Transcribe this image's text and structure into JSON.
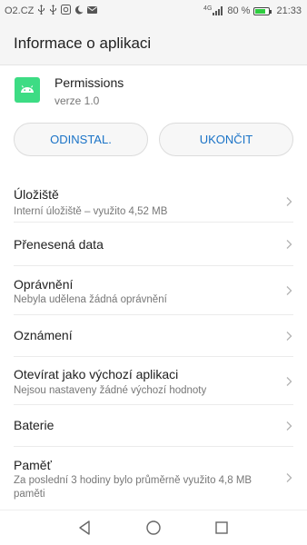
{
  "status_bar": {
    "carrier": "O2.CZ",
    "network": "4G",
    "battery": "80 %",
    "battery_level": 0.8,
    "time": "21:33",
    "icons": [
      "usb-icon",
      "usb-icon",
      "shield-icon",
      "moon-icon",
      "mail-icon"
    ]
  },
  "header": {
    "title": "Informace o aplikaci"
  },
  "app": {
    "name": "Permissions",
    "version": "verze 1.0",
    "icon": "android-icon",
    "icon_color": "#3ddc84"
  },
  "buttons": {
    "uninstall": "ODINSTAL.",
    "force_stop": "UKONČIT",
    "accent_color": "#1a73c7"
  },
  "list": [
    {
      "title": "Úložiště",
      "subtitle": "Interní úložiště – využito 4,52 MB"
    },
    {
      "title": "Přenesená data",
      "subtitle": ""
    },
    {
      "title": "Oprávnění",
      "subtitle": "Nebyla udělena žádná oprávnění"
    },
    {
      "title": "Oznámení",
      "subtitle": ""
    },
    {
      "title": "Otevírat jako výchozí aplikaci",
      "subtitle": "Nejsou nastaveny žádné výchozí hodnoty"
    },
    {
      "title": "Baterie",
      "subtitle": ""
    },
    {
      "title": "Paměť",
      "subtitle": "Za poslední 3 hodiny bylo průměrně využito 4,8 MB paměti"
    }
  ],
  "nav": {
    "back": "back-icon",
    "home": "home-icon",
    "recents": "recents-icon"
  }
}
